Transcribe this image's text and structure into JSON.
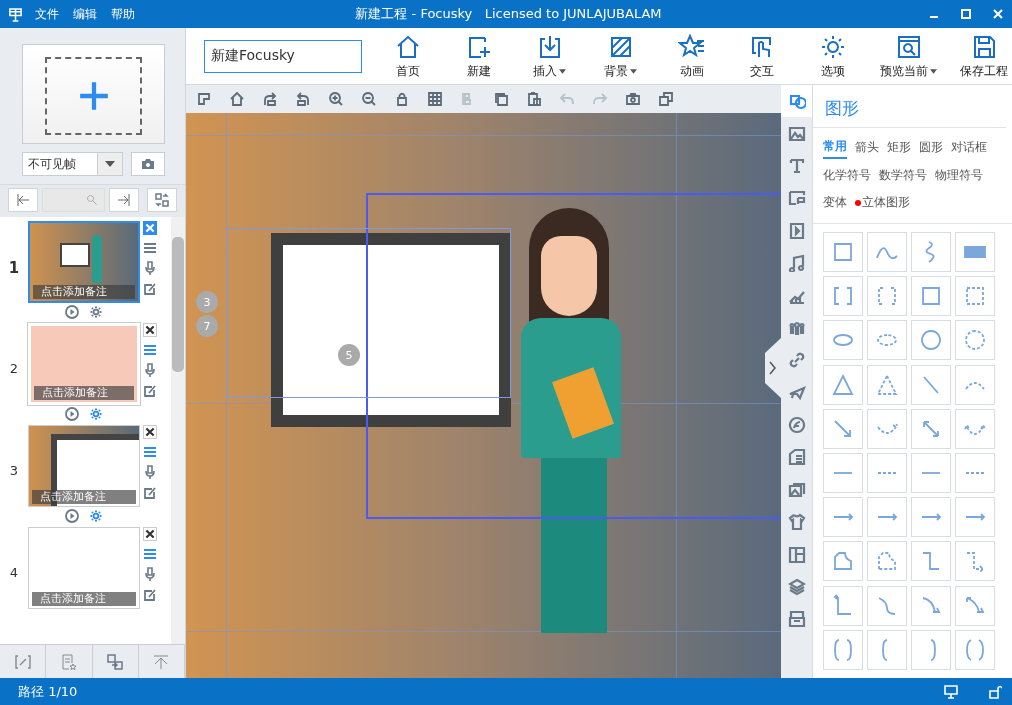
{
  "window": {
    "title": "新建工程 - Focusky   Licensed to JUNLAJUBALAM"
  },
  "menu": [
    "文件",
    "编辑",
    "帮助"
  ],
  "project_name": {
    "value": "新建Focusky"
  },
  "toolbar": [
    {
      "kind": "home",
      "label": "首页",
      "dropdown": false
    },
    {
      "kind": "new",
      "label": "新建",
      "dropdown": false
    },
    {
      "kind": "insert",
      "label": "插入",
      "dropdown": true
    },
    {
      "kind": "background",
      "label": "背景",
      "dropdown": true
    },
    {
      "kind": "animation",
      "label": "动画",
      "dropdown": false
    },
    {
      "kind": "interaction",
      "label": "交互",
      "dropdown": false
    },
    {
      "kind": "options",
      "label": "选项",
      "dropdown": false
    },
    {
      "kind": "preview",
      "label": "预览当前",
      "dropdown": true
    },
    {
      "kind": "save",
      "label": "保存工程",
      "dropdown": false
    }
  ],
  "canvas_tools": [
    {
      "kind": "ruler",
      "disabled": false
    },
    {
      "kind": "home",
      "disabled": false
    },
    {
      "kind": "rotate-right",
      "disabled": false
    },
    {
      "kind": "rotate-left",
      "disabled": false
    },
    {
      "kind": "zoom-in",
      "disabled": false
    },
    {
      "kind": "zoom-out",
      "disabled": false
    },
    {
      "kind": "lock",
      "disabled": false
    },
    {
      "kind": "grid",
      "disabled": false
    },
    {
      "kind": "align",
      "disabled": true
    },
    {
      "kind": "copy",
      "disabled": false
    },
    {
      "kind": "paste",
      "disabled": false
    },
    {
      "kind": "undo",
      "disabled": true
    },
    {
      "kind": "redo",
      "disabled": true
    },
    {
      "kind": "camera",
      "disabled": false
    },
    {
      "kind": "layers",
      "disabled": false
    }
  ],
  "frame_type": {
    "value": "不可见帧"
  },
  "frames": [
    {
      "number": "1",
      "note": "点击添加备注",
      "selected": true,
      "kind": "scene"
    },
    {
      "number": "2",
      "note": "点击添加备注",
      "selected": false,
      "kind": "pink"
    },
    {
      "number": "3",
      "note": "点击添加备注",
      "selected": false,
      "kind": "board"
    },
    {
      "number": "4",
      "note": "点击添加备注",
      "selected": false,
      "kind": "blank"
    }
  ],
  "canvas": {
    "path_markers": [
      "3",
      "7",
      "5"
    ]
  },
  "side_tabs": [
    {
      "kind": "shape",
      "selected": true
    },
    {
      "kind": "image",
      "selected": false
    },
    {
      "kind": "text",
      "selected": false
    },
    {
      "kind": "frame",
      "selected": false
    },
    {
      "kind": "video",
      "selected": false
    },
    {
      "kind": "music",
      "selected": false
    },
    {
      "kind": "chart",
      "selected": false
    },
    {
      "kind": "people",
      "selected": false
    },
    {
      "kind": "link",
      "selected": false
    },
    {
      "kind": "plane",
      "selected": false
    },
    {
      "kind": "flash",
      "selected": false
    },
    {
      "kind": "list",
      "selected": false
    },
    {
      "kind": "gallery",
      "selected": false
    },
    {
      "kind": "shirt",
      "selected": false
    },
    {
      "kind": "layout",
      "selected": false
    },
    {
      "kind": "layers",
      "selected": false
    },
    {
      "kind": "archive",
      "selected": false
    }
  ],
  "shapes_panel": {
    "title": "图形",
    "categories": [
      {
        "label": "常用",
        "selected": true,
        "new": false
      },
      {
        "label": "箭头",
        "selected": false,
        "new": false
      },
      {
        "label": "矩形",
        "selected": false,
        "new": false
      },
      {
        "label": "圆形",
        "selected": false,
        "new": false
      },
      {
        "label": "对话框",
        "selected": false,
        "new": false
      },
      {
        "label": "化学符号",
        "selected": false,
        "new": false
      },
      {
        "label": "数学符号",
        "selected": false,
        "new": false
      },
      {
        "label": "物理符号",
        "selected": false,
        "new": false
      },
      {
        "label": "变体",
        "selected": false,
        "new": false
      },
      {
        "label": "立体图形",
        "selected": false,
        "new": true
      }
    ]
  },
  "status_bar": {
    "path": "路径 1/10"
  }
}
